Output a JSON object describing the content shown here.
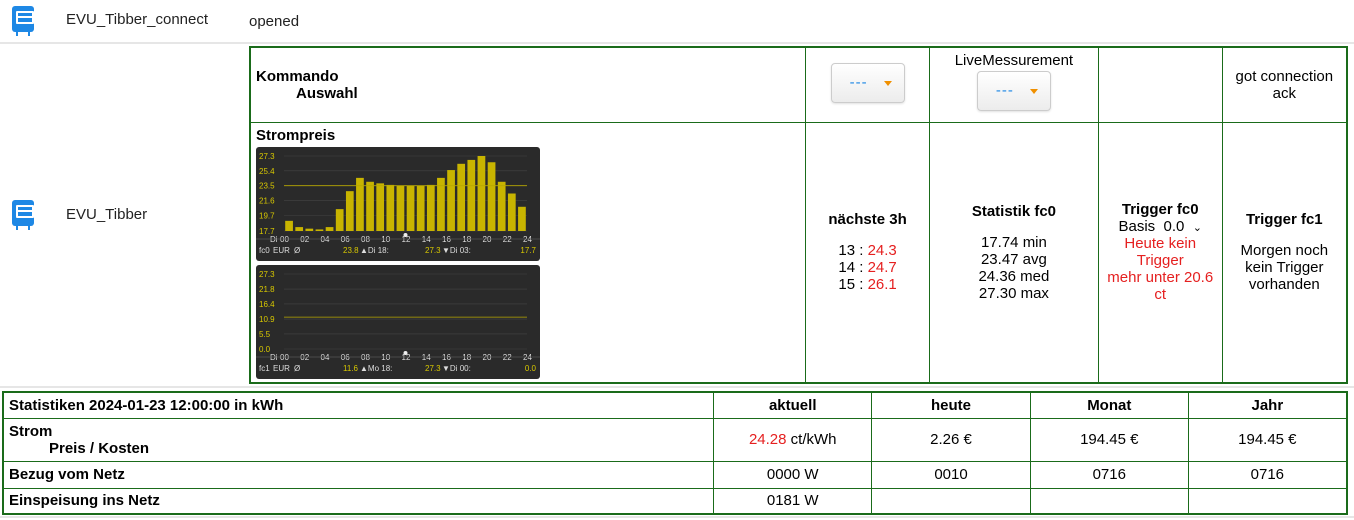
{
  "devices": [
    {
      "name": "EVU_Tibber_connect",
      "status": "opened",
      "icon": "meter-icon"
    },
    {
      "name": "EVU_Tibber",
      "icon": "meter-icon"
    }
  ],
  "panel": {
    "kommando": "Kommando",
    "auswahl": "Auswahl",
    "select1_value": "---",
    "live_label": "LiveMessurement",
    "select2_value": "---",
    "got_conn": "got connection",
    "ack": "ack",
    "strompreis": "Strompreis",
    "next3_title": "nächste 3h",
    "next3": [
      {
        "h": "13",
        "sep": " : ",
        "v": "24.3"
      },
      {
        "h": "14",
        "sep": " : ",
        "v": "24.7"
      },
      {
        "h": "15",
        "sep": " : ",
        "v": "26.1"
      }
    ],
    "stat_title": "Statistik fc0",
    "stat_lines": [
      "17.74 min",
      "23.47 avg",
      "24.36 med",
      "27.30 max"
    ],
    "trig0_title": "Trigger fc0",
    "basis_label": "Basis",
    "basis_value": "0.0",
    "trig0_msg": [
      "Heute kein",
      "Trigger",
      "mehr unter 20.6",
      "ct"
    ],
    "trig1_title": "Trigger fc1",
    "trig1_msg": [
      "Morgen noch",
      "kein Trigger",
      "vorhanden"
    ]
  },
  "chart_data": [
    {
      "type": "bar",
      "title": "",
      "yticks": [
        "27.3",
        "25.4",
        "23.5",
        "21.6",
        "19.7",
        "17.7"
      ],
      "ylim": [
        17.7,
        27.3
      ],
      "xticks": [
        "Di",
        "00",
        "02",
        "04",
        "06",
        "08",
        "10",
        "12",
        "14",
        "16",
        "18",
        "20",
        "22",
        "24"
      ],
      "x": [
        0,
        1,
        2,
        3,
        4,
        5,
        6,
        7,
        8,
        9,
        10,
        11,
        12,
        13,
        14,
        15,
        16,
        17,
        18,
        19,
        20,
        21,
        22,
        23
      ],
      "values": [
        19.0,
        18.2,
        18.0,
        17.9,
        18.2,
        20.5,
        22.8,
        24.5,
        24.0,
        23.8,
        23.6,
        23.5,
        23.5,
        23.5,
        23.6,
        24.5,
        25.5,
        26.3,
        26.8,
        27.3,
        26.5,
        24.0,
        22.5,
        20.8
      ],
      "avg": 23.5,
      "color": "#c8b400",
      "footer": {
        "series": "fc0",
        "unit": "EUR",
        "sym": "Ø",
        "avg": "23.8",
        "max_tag": "▲Di 18:",
        "max": "27.3",
        "min_tag": "▼Di 03:",
        "min": "17.7"
      }
    },
    {
      "type": "line",
      "title": "",
      "yticks": [
        "27.3",
        "21.8",
        "16.4",
        "10.9",
        "5.5",
        "0.0"
      ],
      "ylim": [
        0,
        27.3
      ],
      "xticks": [
        "Di",
        "00",
        "02",
        "04",
        "06",
        "08",
        "10",
        "12",
        "14",
        "16",
        "18",
        "20",
        "22",
        "24"
      ],
      "avg": 11.6,
      "color": "#c8b400",
      "footer": {
        "series": "fc1",
        "unit": "EUR",
        "sym": "Ø",
        "avg": "11.6",
        "max_tag": "▲Mo 18:",
        "max": "27.3",
        "min_tag": "▼Di 00:",
        "min": "0.0"
      }
    }
  ],
  "stats": {
    "title": "Statistiken 2024-01-23 12:00:00 in kWh",
    "headers": [
      "aktuell",
      "heute",
      "Monat",
      "Jahr"
    ],
    "strom": "Strom",
    "preis": "Preis / Kosten",
    "price_val": "24.28",
    "price_unit": " ct/kWh",
    "strom_row": [
      "2.26 €",
      "194.45 €",
      "194.45 €"
    ],
    "bezug_label": "Bezug vom Netz",
    "bezug": [
      "0000 W",
      "0010",
      "0716",
      "0716"
    ],
    "einspeisung_label": "Einspeisung ins Netz",
    "einspeisung": [
      "0181 W",
      "",
      "",
      ""
    ]
  }
}
